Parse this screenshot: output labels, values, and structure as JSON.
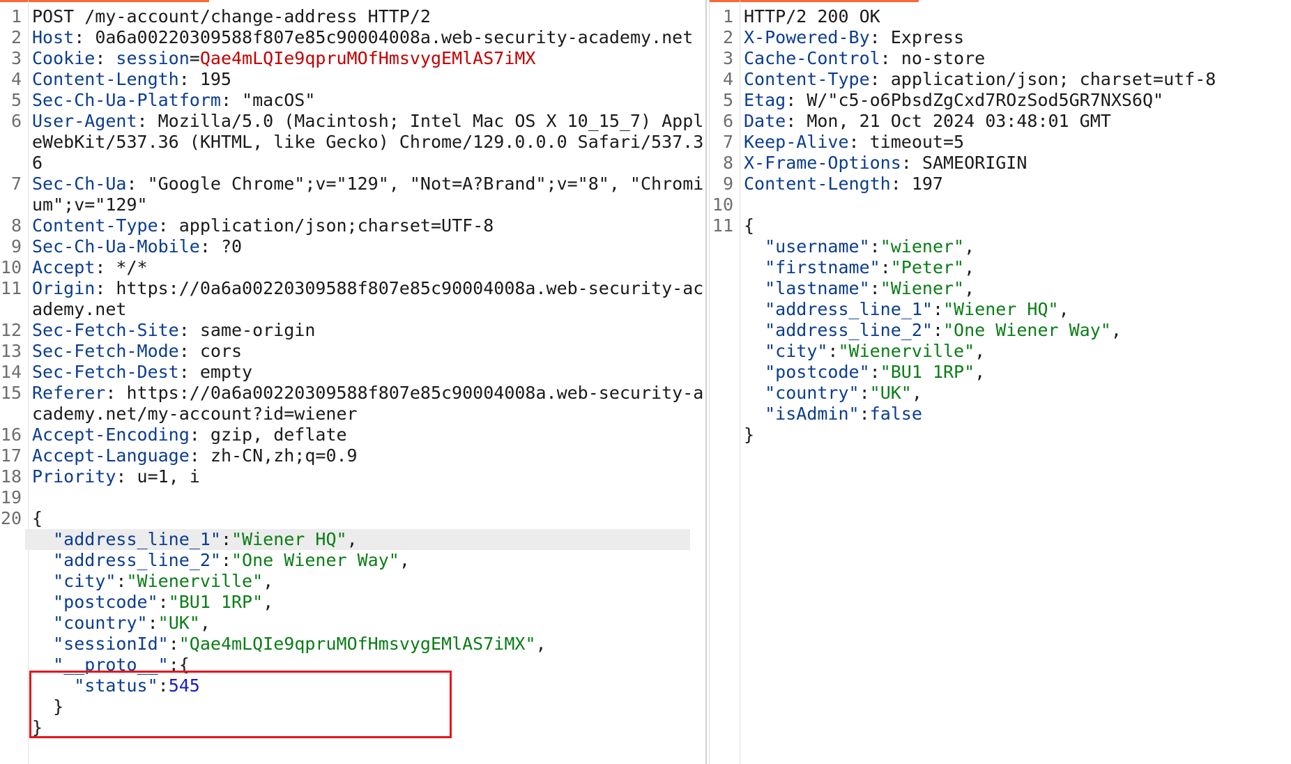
{
  "request": {
    "headers": [
      {
        "num": "1",
        "text": "POST /my-account/change-address HTTP/2"
      },
      {
        "num": "2",
        "name": "Host",
        "value": "0a6a00220309588f807e85c90004008a.web-security-academy.net"
      },
      {
        "num": "3",
        "name": "Cookie",
        "cookie_name": "session",
        "cookie_value": "Qae4mLQIe9qpruMOfHmsvygEMlAS7iMX"
      },
      {
        "num": "4",
        "name": "Content-Length",
        "value": "195"
      },
      {
        "num": "5",
        "name": "Sec-Ch-Ua-Platform",
        "value": "\"macOS\""
      },
      {
        "num": "6",
        "name": "User-Agent",
        "value": "Mozilla/5.0 (Macintosh; Intel Mac OS X 10_15_7) AppleWebKit/537.36 (KHTML, like Gecko) Chrome/129.0.0.0 Safari/537.36"
      },
      {
        "num": "7",
        "name": "Sec-Ch-Ua",
        "value": "\"Google Chrome\";v=\"129\", \"Not=A?Brand\";v=\"8\", \"Chromium\";v=\"129\""
      },
      {
        "num": "8",
        "name": "Content-Type",
        "value": "application/json;charset=UTF-8"
      },
      {
        "num": "9",
        "name": "Sec-Ch-Ua-Mobile",
        "value": "?0"
      },
      {
        "num": "10",
        "name": "Accept",
        "value": "*/*"
      },
      {
        "num": "11",
        "name": "Origin",
        "value": "https://0a6a00220309588f807e85c90004008a.web-security-academy.net"
      },
      {
        "num": "12",
        "name": "Sec-Fetch-Site",
        "value": "same-origin"
      },
      {
        "num": "13",
        "name": "Sec-Fetch-Mode",
        "value": "cors"
      },
      {
        "num": "14",
        "name": "Sec-Fetch-Dest",
        "value": "empty"
      },
      {
        "num": "15",
        "name": "Referer",
        "value": "https://0a6a00220309588f807e85c90004008a.web-security-academy.net/my-account?id=wiener"
      },
      {
        "num": "16",
        "name": "Accept-Encoding",
        "value": "gzip, deflate"
      },
      {
        "num": "17",
        "name": "Accept-Language",
        "value": "zh-CN,zh;q=0.9"
      },
      {
        "num": "18",
        "name": "Priority",
        "value": "u=1, i"
      },
      {
        "num": "19",
        "text": ""
      }
    ],
    "body_line_num": "20",
    "body_open": "{",
    "body_close": "}",
    "body": [
      {
        "key": "\"address_line_1\"",
        "value": "\"Wiener HQ\"",
        "type": "str",
        "comma": true,
        "highlighted": true
      },
      {
        "key": "\"address_line_2\"",
        "value": "\"One Wiener Way\"",
        "type": "str",
        "comma": true
      },
      {
        "key": "\"city\"",
        "value": "\"Wienerville\"",
        "type": "str",
        "comma": true
      },
      {
        "key": "\"postcode\"",
        "value": "\"BU1 1RP\"",
        "type": "str",
        "comma": true
      },
      {
        "key": "\"country\"",
        "value": "\"UK\"",
        "type": "str",
        "comma": true
      },
      {
        "key": "\"sessionId\"",
        "value": "\"Qae4mLQIe9qpruMOfHmsvygEMlAS7iMX\"",
        "type": "str",
        "comma": true
      }
    ],
    "proto": {
      "key": "\"__proto__\"",
      "open": "{",
      "inner_key": "\"status\"",
      "inner_value": "545",
      "close": "}"
    }
  },
  "response": {
    "headers": [
      {
        "num": "1",
        "text": "HTTP/2 200 OK"
      },
      {
        "num": "2",
        "name": "X-Powered-By",
        "value": "Express"
      },
      {
        "num": "3",
        "name": "Cache-Control",
        "value": "no-store"
      },
      {
        "num": "4",
        "name": "Content-Type",
        "value": "application/json; charset=utf-8"
      },
      {
        "num": "5",
        "name": "Etag",
        "value": "W/\"c5-o6PbsdZgCxd7ROzSod5GR7NXS6Q\""
      },
      {
        "num": "6",
        "name": "Date",
        "value": "Mon, 21 Oct 2024 03:48:01 GMT"
      },
      {
        "num": "7",
        "name": "Keep-Alive",
        "value": "timeout=5"
      },
      {
        "num": "8",
        "name": "X-Frame-Options",
        "value": "SAMEORIGIN"
      },
      {
        "num": "9",
        "name": "Content-Length",
        "value": "197"
      },
      {
        "num": "10",
        "text": ""
      }
    ],
    "body_line_num": "11",
    "body_open": "{",
    "body_close": "}",
    "body": [
      {
        "key": "\"username\"",
        "value": "\"wiener\"",
        "type": "str",
        "comma": true
      },
      {
        "key": "\"firstname\"",
        "value": "\"Peter\"",
        "type": "str",
        "comma": true
      },
      {
        "key": "\"lastname\"",
        "value": "\"Wiener\"",
        "type": "str",
        "comma": true
      },
      {
        "key": "\"address_line_1\"",
        "value": "\"Wiener HQ\"",
        "type": "str",
        "comma": true
      },
      {
        "key": "\"address_line_2\"",
        "value": "\"One Wiener Way\"",
        "type": "str",
        "comma": true
      },
      {
        "key": "\"city\"",
        "value": "\"Wienerville\"",
        "type": "str",
        "comma": true
      },
      {
        "key": "\"postcode\"",
        "value": "\"BU1 1RP\"",
        "type": "str",
        "comma": true
      },
      {
        "key": "\"country\"",
        "value": "\"UK\"",
        "type": "str",
        "comma": true
      },
      {
        "key": "\"isAdmin\"",
        "value": "false",
        "type": "bool",
        "comma": false
      }
    ]
  },
  "colors": {
    "header_name": "#0b3d91",
    "json_key": "#0b3d91",
    "json_string": "#0a7d16",
    "json_number": "#1a1acd",
    "cookie_value": "#c40000",
    "highlight_box": "#e8141e",
    "active_line": "#ececec",
    "tab_accent": "#ff6633"
  }
}
